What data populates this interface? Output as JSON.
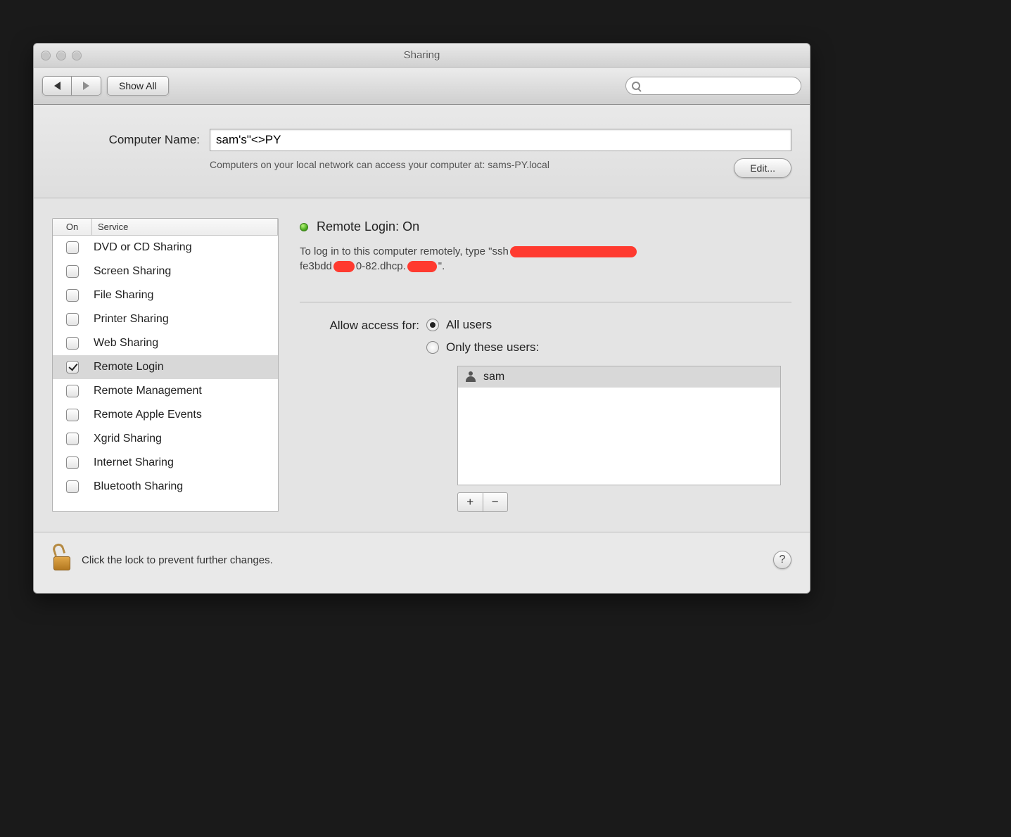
{
  "window": {
    "title": "Sharing"
  },
  "toolbar": {
    "show_all_label": "Show All",
    "search_placeholder": ""
  },
  "computer_name": {
    "label": "Computer Name:",
    "value": "sam's\"<>PY",
    "description": "Computers on your local network can access your computer at: sams-PY.local",
    "edit_label": "Edit..."
  },
  "services": {
    "header_on": "On",
    "header_service": "Service",
    "items": [
      {
        "name": "DVD or CD Sharing",
        "on": false,
        "selected": false
      },
      {
        "name": "Screen Sharing",
        "on": false,
        "selected": false
      },
      {
        "name": "File Sharing",
        "on": false,
        "selected": false
      },
      {
        "name": "Printer Sharing",
        "on": false,
        "selected": false
      },
      {
        "name": "Web Sharing",
        "on": false,
        "selected": false
      },
      {
        "name": "Remote Login",
        "on": true,
        "selected": true
      },
      {
        "name": "Remote Management",
        "on": false,
        "selected": false
      },
      {
        "name": "Remote Apple Events",
        "on": false,
        "selected": false
      },
      {
        "name": "Xgrid Sharing",
        "on": false,
        "selected": false
      },
      {
        "name": "Internet Sharing",
        "on": false,
        "selected": false
      },
      {
        "name": "Bluetooth Sharing",
        "on": false,
        "selected": false
      }
    ]
  },
  "detail": {
    "title": "Remote Login: On",
    "status": "on",
    "login_text_prefix": "To log in to this computer remotely, type \"ssh",
    "login_text_mid1": "fe3bdd",
    "login_text_mid2": "0-82.dhcp.",
    "login_text_suffix": "\".",
    "access_label": "Allow access for:",
    "access_options": {
      "all_users": "All users",
      "only_these": "Only these users:",
      "selected": "all_users"
    },
    "users": [
      {
        "name": "sam"
      }
    ]
  },
  "footer": {
    "lock_text": "Click the lock to prevent further changes.",
    "help_label": "?"
  }
}
